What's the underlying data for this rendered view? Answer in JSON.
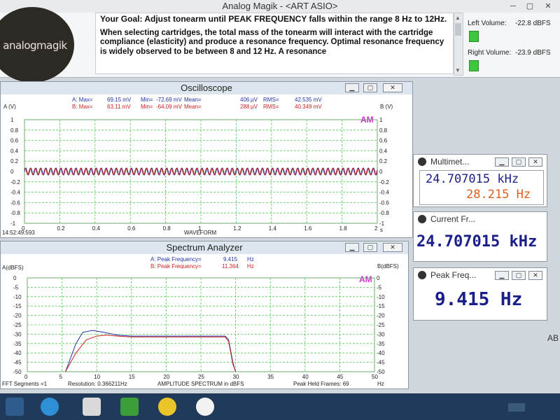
{
  "window": {
    "title": "Analog Magik  -  <ART ASIO>"
  },
  "logo": {
    "text": "analogmagik"
  },
  "goal": {
    "heading": "Your Goal:  Adjust tonearm until PEAK FREQUENCY falls within the range 8 Hz to 12Hz.",
    "body": "When selecting cartridges, the total mass of the tonearm will interact with the cartridge compliance (elasticity) and produce a resonance frequency.   Optimal resonance frequency is widely observed to be between 8 and 12 Hz.  A resonance"
  },
  "volume": {
    "left_label": "Left Volume:",
    "left_value": "-22.8 dBFS",
    "right_label": "Right Volume:",
    "right_value": "-23.9 dBFS"
  },
  "oscilloscope": {
    "title": "Oscilloscope",
    "stats_a": {
      "label": "A: Max=",
      "max": "69.15 mV",
      "min_label": "Min=",
      "min": "-72.69 mV",
      "mean_label": "Mean=",
      "mean": "406",
      "unit": "µV",
      "rms_label": "RMS=",
      "rms": "42.535 mV"
    },
    "stats_b": {
      "label": "B: Max=",
      "max": "63.11 mV",
      "min_label": "Min=",
      "min": "-64.09 mV",
      "mean_label": "Mean=",
      "mean": "288",
      "unit": "µV",
      "rms_label": "RMS=",
      "rms": "40.349 mV"
    },
    "left_axis": "A (V)",
    "right_axis": "B (V)",
    "am": "AM",
    "xlabel": "WAVEFORM",
    "xunit": "s",
    "timestamp": "14:52:49:593",
    "colors": {
      "a": "#2233aa",
      "b": "#cc2222",
      "grid": "#55cc55",
      "am": "#cc33cc"
    }
  },
  "spectrum": {
    "title": "Spectrum Analyzer",
    "peak_a_label": "A: Peak Frequency=",
    "peak_a": "9.415",
    "peak_a_unit": "Hz",
    "peak_b_label": "B: Peak Frequency=",
    "peak_b": "11.364",
    "peak_b_unit": "Hz",
    "left_axis": "A(dBFS)",
    "right_axis": "B(dBFS)",
    "am": "AM",
    "footer_segments": "FFT Segments =1",
    "footer_resolution": "Resolution: 0.366211Hz",
    "footer_label": "AMPLITUDE SPECTRUM in dBFS",
    "footer_frames": "Peak Held Frames: 69",
    "xunit": "Hz"
  },
  "multimeter": {
    "title": "Multimet...",
    "value1": "24.707015 kHz",
    "value2": "28.215 Hz"
  },
  "current_freq": {
    "title": "Current Fr...",
    "value": "24.707015 kHz"
  },
  "peak_freq": {
    "title": "Peak Freq...",
    "value": "9.415 Hz"
  },
  "edge_text": "AB",
  "chart_data": [
    {
      "type": "line",
      "title": "Oscilloscope",
      "xlabel": "WAVEFORM",
      "ylabel": "A (V)",
      "y2label": "B (V)",
      "xlim": [
        0,
        2
      ],
      "ylim": [
        -1,
        1
      ],
      "x_ticks": [
        "0",
        "0.2",
        "0.4",
        "0.6",
        "0.8",
        "1",
        "1.2",
        "1.4",
        "1.6",
        "1.8",
        "2"
      ],
      "y_ticks": [
        "1",
        "0.8",
        "0.6",
        "0.4",
        "0.2",
        "0",
        "-0.2",
        "-0.4",
        "-0.6",
        "-0.8",
        "-1"
      ],
      "grid": true,
      "series": [
        {
          "name": "A",
          "amplitude": 0.069,
          "cycles": 70
        },
        {
          "name": "B",
          "amplitude": 0.064,
          "cycles": 70
        }
      ]
    },
    {
      "type": "line",
      "title": "Spectrum Analyzer",
      "xlabel": "AMPLITUDE SPECTRUM in dBFS",
      "ylabel": "A(dBFS)",
      "y2label": "B(dBFS)",
      "xlim": [
        0,
        50
      ],
      "ylim": [
        -50,
        0
      ],
      "x_ticks": [
        "0",
        "5",
        "10",
        "15",
        "20",
        "25",
        "30",
        "35",
        "40",
        "45",
        "50"
      ],
      "y_ticks": [
        "0",
        "-5",
        "-10",
        "-15",
        "-20",
        "-25",
        "-30",
        "-35",
        "-40",
        "-45",
        "-50"
      ],
      "grid": true,
      "series": [
        {
          "name": "A",
          "x": [
            5.5,
            7,
            8,
            9.4,
            11,
            13,
            15,
            20,
            25,
            28.5,
            29,
            29.6,
            30
          ],
          "y": [
            -50,
            -35,
            -29,
            -28,
            -29,
            -30.5,
            -31,
            -31,
            -31,
            -31,
            -33,
            -45,
            -50
          ]
        },
        {
          "name": "B",
          "x": [
            5.5,
            7,
            8.5,
            10,
            11.4,
            13,
            15,
            20,
            25,
            28.5,
            29,
            29.6,
            30
          ],
          "y": [
            -50,
            -40,
            -33,
            -31,
            -30.5,
            -31,
            -31.5,
            -31.5,
            -31.5,
            -31.5,
            -34,
            -46,
            -50
          ]
        }
      ]
    }
  ]
}
